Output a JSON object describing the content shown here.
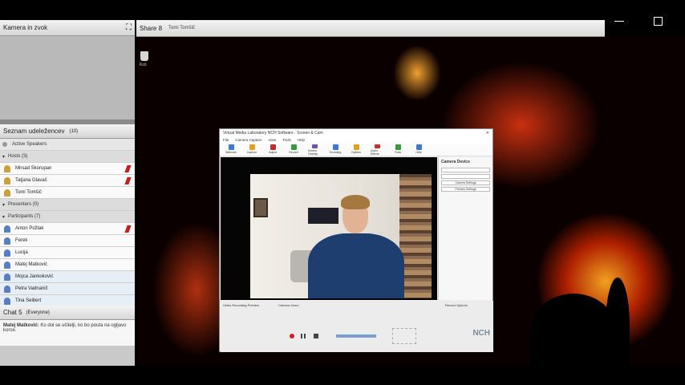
{
  "camera_pod": {
    "title": "Kamera in zvok"
  },
  "attendees_pod": {
    "title": "Seznam udeležencev",
    "count": "(10)",
    "active_speakers": "Active Speakers",
    "groups": [
      {
        "label": "Hosts (3)",
        "members": [
          "Mirsad Skorupan",
          "Tatjana Glavač",
          "Tomi Tomšič"
        ]
      },
      {
        "label": "Presenters (0)",
        "members": []
      },
      {
        "label": "Participants (7)",
        "members": [
          "Anton Požlak",
          "Ferek",
          "Lucija",
          "Matej Matković",
          "Mojca Jankoković",
          "Petra Vadnanič",
          "Tina Seibert"
        ]
      }
    ]
  },
  "chat_pod": {
    "title": "Chat 5",
    "scope": "(Everyone)",
    "author": "Matej Matković:",
    "message": "Ko dol se učitelji, ko bo pouta na ogljavo korce."
  },
  "share_pod": {
    "title": "Share 8",
    "presenter": "Tomi Tomšič"
  },
  "desktop": {
    "icon_label": "Koš"
  },
  "app_window": {
    "title": "Virtual Media Laboratory NCH Software - Screen & Cam",
    "menus": [
      "File",
      "Camera Capture",
      "View",
      "Tools",
      "Help"
    ],
    "tools": [
      "Webcam",
      "Capture",
      "Adjust",
      "Record",
      "Screen Overlay",
      "Encoding",
      "Options",
      "Audio Effects",
      "Tools",
      "Help"
    ],
    "side_title": "Camera Device",
    "side_buttons": [
      "Camera Settings",
      "Preview Settings"
    ],
    "bottom_labels": [
      "Video Recording Preview",
      "Camera Zoom",
      "Record Options"
    ],
    "brand": "NCH"
  }
}
